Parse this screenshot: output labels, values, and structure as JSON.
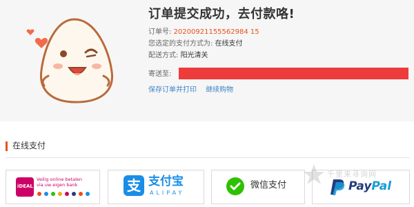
{
  "success": {
    "title": "订单提交成功，去付款咯!",
    "order_label": "订单号:",
    "order_number": "20200921155562984 15",
    "payment_method_label": "您选定的支付方式为:",
    "payment_method_value": "在线支付",
    "delivery_label": "配送方式:",
    "delivery_value": "阳光清关",
    "address_label": "寄送至:",
    "link_save_print": "保存订单并打印",
    "link_continue": "继续购物"
  },
  "payment": {
    "section_title": "在线支付",
    "options": [
      {
        "id": "ideal",
        "logo_text": "iDEAL",
        "line1": "Veilig online betalen",
        "line2": "via uw eigen bank"
      },
      {
        "id": "alipay",
        "name_cn": "支付宝",
        "name_en": "ALIPAY"
      },
      {
        "id": "wechat",
        "name": "微信支付"
      },
      {
        "id": "paypal",
        "name_pay": "Pay",
        "name_pal": "Pal"
      }
    ]
  },
  "watermark": {
    "text": "千里来寻询网"
  },
  "colors": {
    "accent": "#e8501c",
    "address_bar": "#ee3b3b",
    "link": "#3d84c6",
    "alipay": "#1a8ee6",
    "wechat": "#2dc100",
    "ideal": "#cc0066",
    "paypal_dark": "#253b80",
    "paypal_light": "#179bd7"
  },
  "icons": [
    "mascot-rice-ball-icon",
    "ideal-logo-icon",
    "alipay-logo-icon",
    "wechat-pay-icon",
    "paypal-logo-icon",
    "watermark-star-icon"
  ]
}
